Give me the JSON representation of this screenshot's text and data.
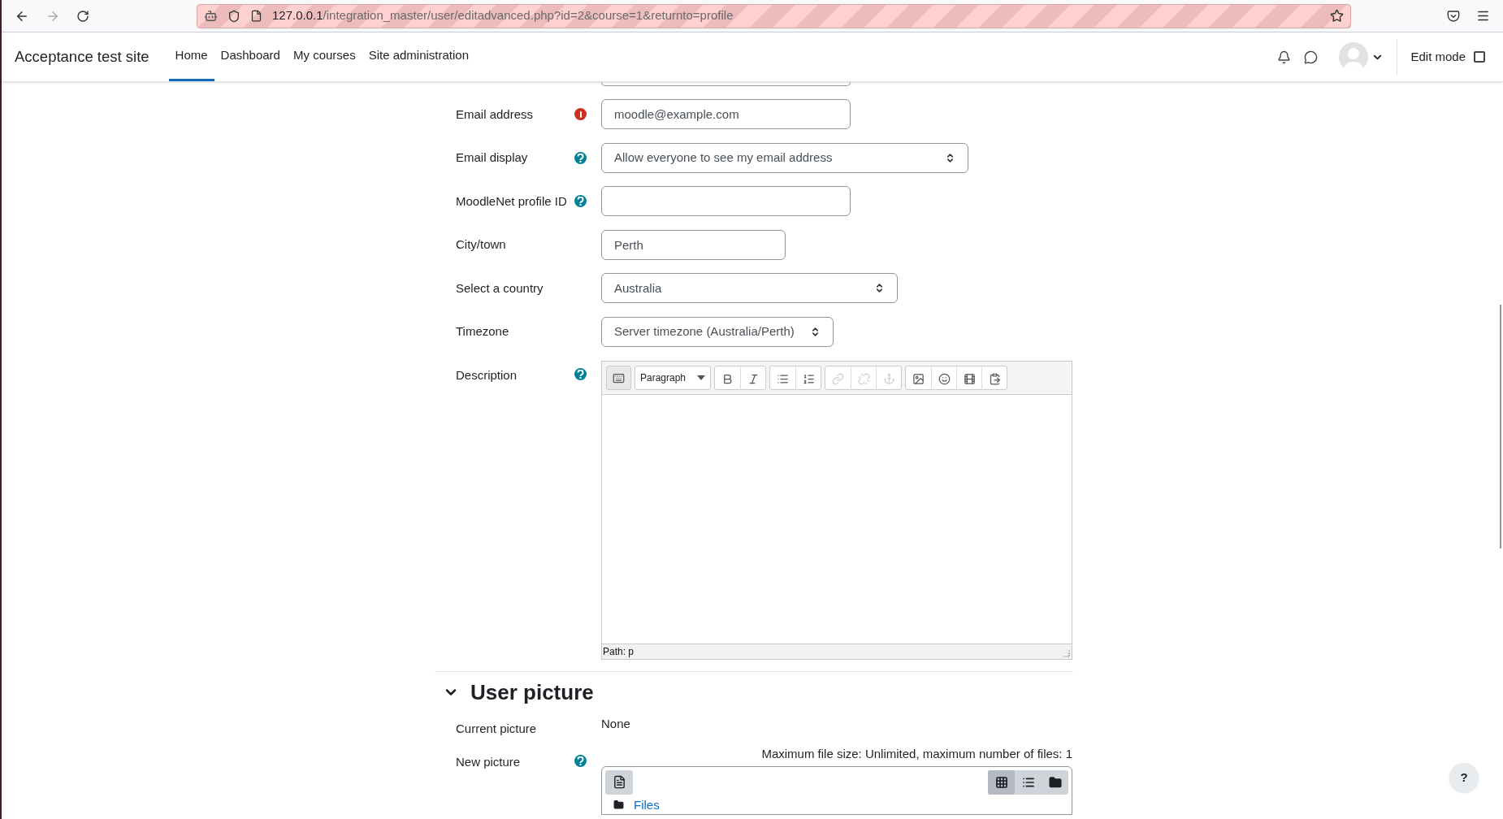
{
  "browser": {
    "url_host": "127.0.0.1",
    "url_path": "/integration_master/user/editadvanced.php?id=2&course=1&returnto=profile"
  },
  "navbar": {
    "site_name": "Acceptance test site",
    "items": [
      {
        "label": "Home",
        "selected": true
      },
      {
        "label": "Dashboard",
        "selected": false
      },
      {
        "label": "My courses",
        "selected": false
      },
      {
        "label": "Site administration",
        "selected": false
      }
    ],
    "edit_mode": {
      "label": "Edit mode",
      "checked": false
    }
  },
  "fields": [
    {
      "label": "Email address",
      "error": true,
      "help": false,
      "kind": "text",
      "value": "moodle@example.com"
    },
    {
      "label": "Email display",
      "error": false,
      "help": true,
      "kind": "select",
      "value": "Allow everyone to see my email address"
    },
    {
      "label": "MoodleNet profile ID",
      "error": false,
      "help": true,
      "kind": "text"
    },
    {
      "label": "City/town",
      "error": false,
      "help": false,
      "kind": "text",
      "value": "Perth"
    },
    {
      "label": "Select a country",
      "error": false,
      "help": false,
      "kind": "select",
      "value": "Australia"
    },
    {
      "label": "Timezone",
      "error": false,
      "help": false,
      "kind": "select",
      "value": "Server timezone (Australia/Perth)"
    }
  ],
  "description": {
    "label": "Description",
    "format": "Paragraph",
    "path": "Path: p",
    "toolbar": [
      [
        {
          "kind": "keyboard",
          "disabled": false
        }
      ],
      [
        {
          "kind": "bold",
          "disabled": false
        },
        {
          "kind": "italic",
          "disabled": false
        }
      ],
      [
        {
          "kind": "bullets",
          "disabled": false
        },
        {
          "kind": "numbers",
          "disabled": false
        }
      ],
      [
        {
          "kind": "link",
          "disabled": true
        },
        {
          "kind": "unlink",
          "disabled": true
        },
        {
          "kind": "anchor",
          "disabled": true
        }
      ],
      [
        {
          "kind": "image",
          "disabled": false
        },
        {
          "kind": "emoji",
          "disabled": false
        },
        {
          "kind": "media",
          "disabled": false
        },
        {
          "kind": "files",
          "disabled": false
        }
      ]
    ]
  },
  "user_picture": {
    "title": "User picture",
    "expanded": true,
    "current_label": "Current picture",
    "current_value": "None",
    "new_label": "New picture",
    "limits": "Maximum file size: Unlimited, maximum number of files: 1",
    "views": [
      {
        "kind": "icons",
        "selected": true
      },
      {
        "kind": "list",
        "selected": false
      },
      {
        "kind": "tree",
        "selected": false
      }
    ],
    "folder": "Files"
  },
  "help_button": "?"
}
